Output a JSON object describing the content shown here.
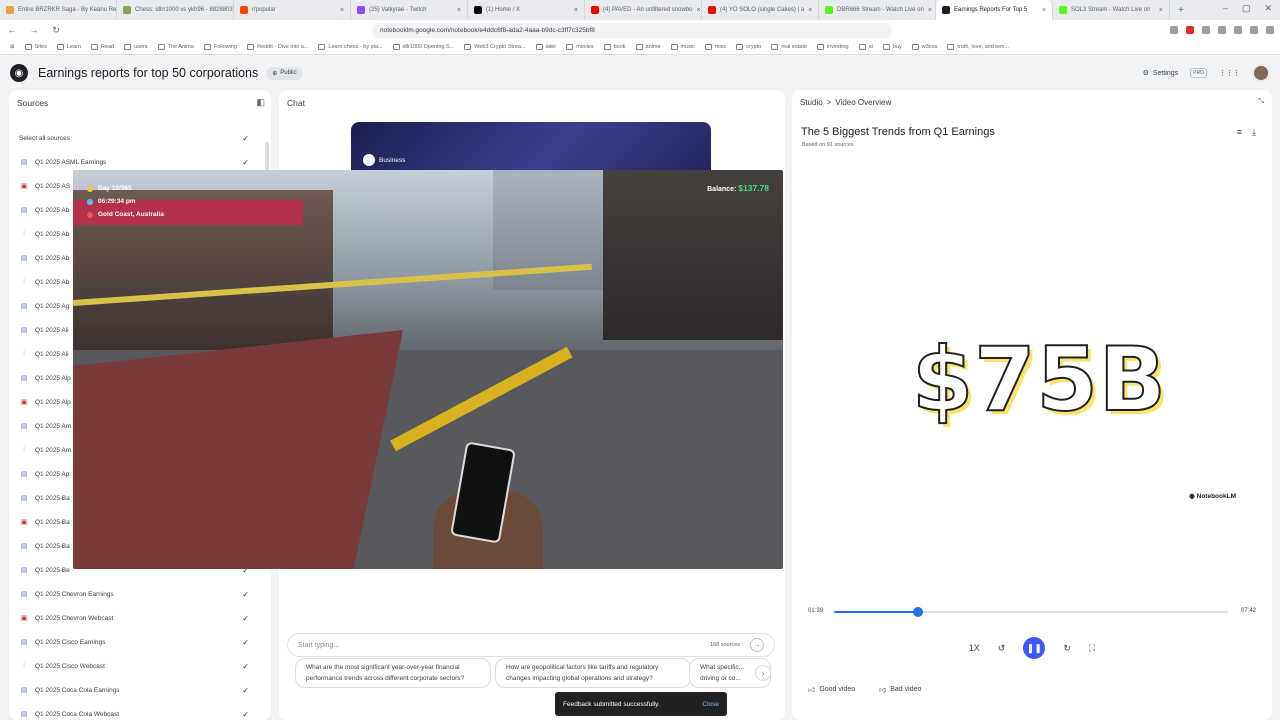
{
  "tabs": [
    {
      "title": "Entire BRZRKR Saga - By Keanu Re",
      "color": "#e8a33d"
    },
    {
      "title": "Chess: idlrr1000 vs ykh96 - 8828803",
      "color": "#7fa650"
    },
    {
      "title": "r/popular",
      "color": "#ff4500"
    },
    {
      "title": "(25) Valkyrae - Twitch",
      "color": "#9146ff"
    },
    {
      "title": "(1) Home / X",
      "color": "#000000"
    },
    {
      "title": "(4) PAVED - An unfiltered snowbo",
      "color": "#ff0000"
    },
    {
      "title": "(4) YO SOLO (single Cakes) | a",
      "color": "#ff0000"
    },
    {
      "title": "DBR666 Stream - Watch Live on",
      "color": "#53fc18"
    },
    {
      "title": "Earnings Reports For Top 5",
      "color": "#202124",
      "active": true
    },
    {
      "title": "SOL3 Stream - Watch Live on",
      "color": "#53fc18"
    }
  ],
  "new_tab": "+",
  "url": "notebooklm.google.com/notebook/e4ddc6f8-ada2-4aaa-b9dc-c3ff7c325bf8",
  "bookmarks": [
    "Sites",
    "Learn",
    "Read",
    "users",
    "The Anima",
    "Following",
    "Reddit - Dive into a...",
    "Learn chess - by pla...",
    "idlr1000 Opening S...",
    "Web3 Crypto Strea...",
    "later",
    "movies",
    "book",
    "anime",
    "music",
    "misc",
    "crypto",
    "real estate",
    "investing",
    "ai",
    "buy",
    "w3cos",
    "truth, love, and tem..."
  ],
  "app": {
    "title": "Earnings reports for top 50 corporations",
    "public_label": "Public",
    "settings_label": "Settings",
    "pro_label": "PRO"
  },
  "sources": {
    "title": "Sources",
    "select_all": "Select all sources",
    "items": [
      {
        "label": "Q1 2025 ASML Earnings",
        "type": "doc"
      },
      {
        "label": "Q1 2025 AS",
        "type": "pdf"
      },
      {
        "label": "Q1 2025 Ab",
        "type": "doc"
      },
      {
        "label": "Q1 2025 Ab",
        "type": "aud"
      },
      {
        "label": "Q1 2025 Ab",
        "type": "doc"
      },
      {
        "label": "Q1 2025 Ab",
        "type": "aud"
      },
      {
        "label": "Q1 2025 Ag",
        "type": "doc"
      },
      {
        "label": "Q1 2025 Ali",
        "type": "doc"
      },
      {
        "label": "Q1 2025 Ali",
        "type": "aud"
      },
      {
        "label": "Q1 2025 Alp",
        "type": "doc"
      },
      {
        "label": "Q1 2025 Alp",
        "type": "pdf"
      },
      {
        "label": "Q1 2025 Am",
        "type": "doc"
      },
      {
        "label": "Q1 2025 Am",
        "type": "aud"
      },
      {
        "label": "Q1 2025 Ap",
        "type": "doc"
      },
      {
        "label": "Q1 2025 Ba",
        "type": "doc"
      },
      {
        "label": "Q1 2025 Ba",
        "type": "pdf"
      },
      {
        "label": "Q1 2025 Ba",
        "type": "doc"
      },
      {
        "label": "Q1 2025 Be",
        "type": "doc"
      },
      {
        "label": "Q1 2025 Chevron Earnings",
        "type": "doc"
      },
      {
        "label": "Q1 2025 Chevron Webcast",
        "type": "pdf"
      },
      {
        "label": "Q1 2025 Cisco Earnings",
        "type": "doc"
      },
      {
        "label": "Q1 2025 Cisco Webcast",
        "type": "aud"
      },
      {
        "label": "Q1 2025 Coca Cola Earnings",
        "type": "doc"
      },
      {
        "label": "Q1 2025 Coca Cola Webcast",
        "type": "doc"
      }
    ]
  },
  "chat": {
    "title": "Chat",
    "card_chip": "Business",
    "input_placeholder": "Start typing...",
    "source_count": "168 sources",
    "suggestions": [
      "What are the most significant year-over-year financial performance trends across different corporate sectors?",
      "How are geopolitical factors like tariffs and regulatory changes impacting global operations and strategy?",
      "What specific... driving or co..."
    ]
  },
  "video_overlay": {
    "day": "Day 10/365",
    "time": "06:29:34 pm",
    "location": "Gold Coast, Australia",
    "balance_label": "Balance:",
    "balance_value": "$137.78"
  },
  "studio": {
    "crumb_root": "Studio",
    "crumb_sep": ">",
    "crumb_current": "Video Overview",
    "video_title": "The 5 Biggest Trends from Q1 Earnings",
    "video_subtitle": "Based on 91 sources",
    "big_text": "$75B",
    "watermark": "NotebookLM",
    "time_current": "01:39",
    "time_total": "07:42",
    "progress_fraction": 0.214,
    "speed": "1X",
    "good_label": "Good video",
    "bad_label": "Bad video"
  },
  "toast": {
    "message": "Feedback submitted successfully.",
    "close": "Close"
  }
}
